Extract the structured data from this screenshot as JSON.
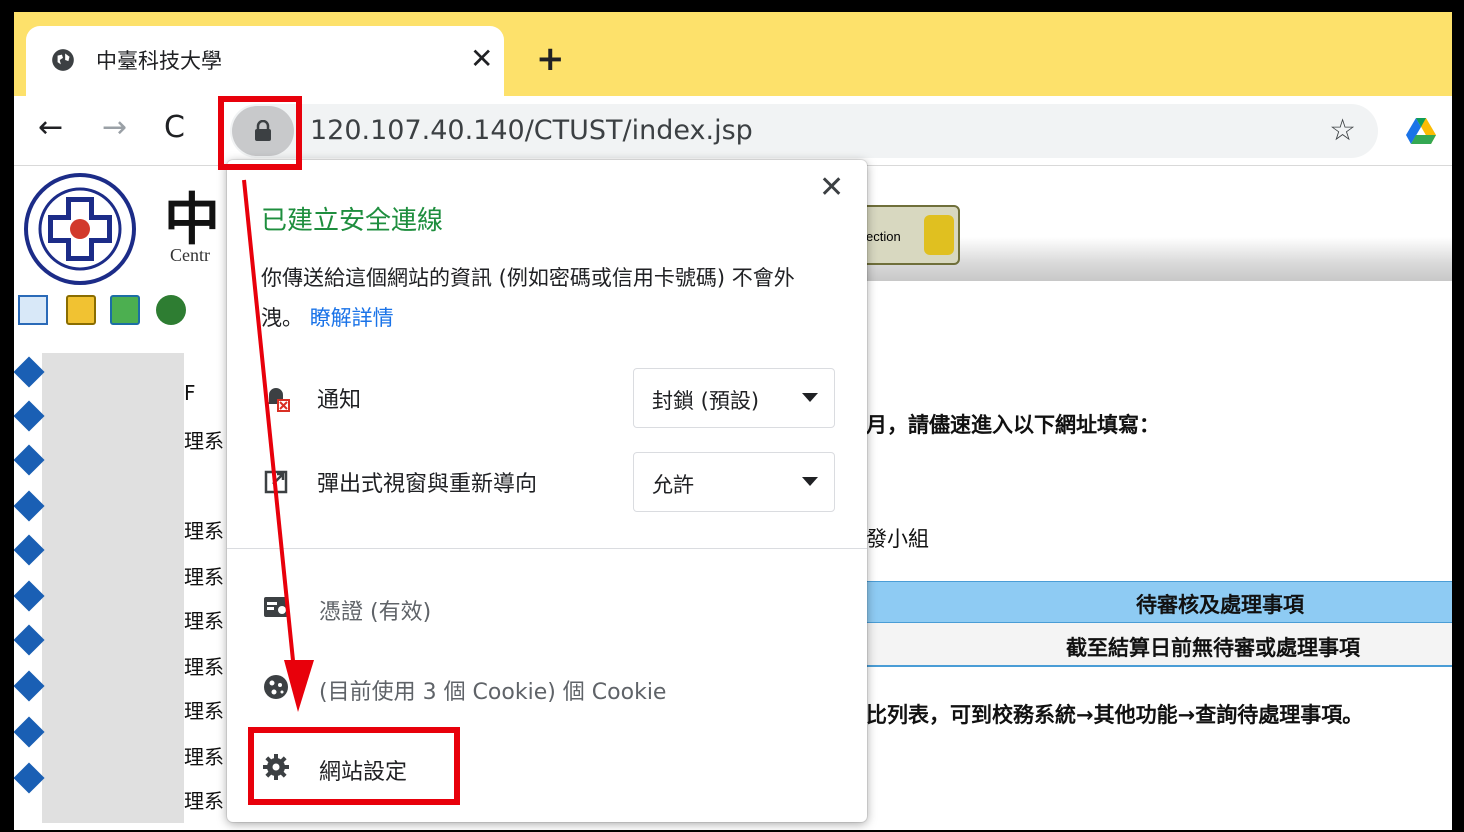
{
  "browser": {
    "tab": {
      "title": "中臺科技大學",
      "close_glyph": "✕",
      "icon": "globe-icon"
    },
    "new_tab_glyph": "+",
    "nav": {
      "back": "←",
      "forward": "→",
      "reload": "C"
    },
    "omnibox": {
      "url": "120.107.40.140/CTUST/index.jsp",
      "lock_icon": "lock-icon",
      "star_glyph": "☆"
    },
    "extension_icon": "google-drive-icon"
  },
  "page": {
    "school_char": "中",
    "school_small": "Centr",
    "badge_text": "ection",
    "sidebar_texts": [
      "F",
      "理系",
      "理系",
      "理系",
      "理系",
      "理系",
      "理系",
      "理系",
      "理系"
    ],
    "content_lines": {
      "fill_notice": "月，請儘速進入以下網址填寫：",
      "group": "發小組",
      "list_note": "比列表，可到校務系統→其他功能→查詢待處理事項。"
    },
    "table": {
      "header": "待審核及處理事項",
      "row": "截至結算日前無待審或處理事項"
    }
  },
  "popup": {
    "close_glyph": "✕",
    "title": "已建立安全連線",
    "description": "你傳送給這個網站的資訊 (例如密碼或信用卡號碼) 不會外洩。",
    "learn_more": "瞭解詳情",
    "permissions": [
      {
        "label": "通知",
        "value": "封鎖 (預設)",
        "icon": "notification-blocked-icon"
      },
      {
        "label": "彈出式視窗與重新導向",
        "value": "允許",
        "icon": "popup-redirect-icon"
      }
    ],
    "menu": [
      {
        "label": "憑證 (有效)",
        "icon": "certificate-icon"
      },
      {
        "label": "(目前使用 3 個 Cookie) 個 Cookie",
        "icon": "cookie-icon"
      },
      {
        "label": "網站設定",
        "icon": "gear-icon"
      }
    ]
  },
  "colors": {
    "tabstrip": "#fde16b",
    "secure_title": "#1e8e3e",
    "link": "#1a73e8",
    "annotation": "#e8000b",
    "table_header": "#8ecbf3"
  }
}
